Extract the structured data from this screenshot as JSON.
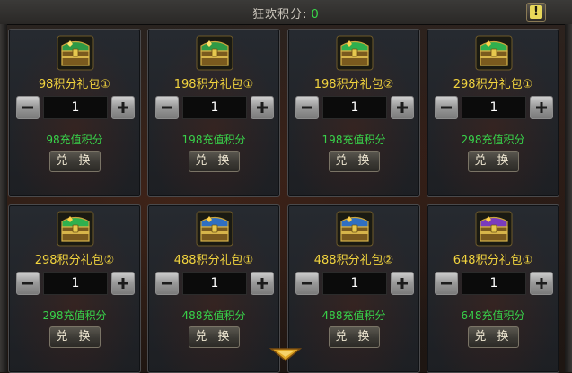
{
  "header": {
    "score_label": "狂欢积分:",
    "score_value": "0"
  },
  "redeem_label": "兑 换",
  "colors": {
    "title": "#f2d43e",
    "points": "#38d24a",
    "score": "#39d84a"
  },
  "items": [
    {
      "name": "98积分礼包①",
      "quantity": "1",
      "points": "98充值积分",
      "chest_icon": "green-treasure-chest"
    },
    {
      "name": "198积分礼包①",
      "quantity": "1",
      "points": "198充值积分",
      "chest_icon": "green-treasure-chest"
    },
    {
      "name": "198积分礼包②",
      "quantity": "1",
      "points": "198充值积分",
      "chest_icon": "green-gold-treasure-chest"
    },
    {
      "name": "298积分礼包①",
      "quantity": "1",
      "points": "298充值积分",
      "chest_icon": "green-gold-treasure-chest"
    },
    {
      "name": "298积分礼包②",
      "quantity": "1",
      "points": "298充值积分",
      "chest_icon": "green-gold-treasure-chest"
    },
    {
      "name": "488积分礼包①",
      "quantity": "1",
      "points": "488充值积分",
      "chest_icon": "blue-gold-treasure-chest"
    },
    {
      "name": "488积分礼包②",
      "quantity": "1",
      "points": "488充值积分",
      "chest_icon": "blue-gold-treasure-chest"
    },
    {
      "name": "648积分礼包①",
      "quantity": "1",
      "points": "648充值积分",
      "chest_icon": "purple-gold-treasure-chest"
    }
  ]
}
